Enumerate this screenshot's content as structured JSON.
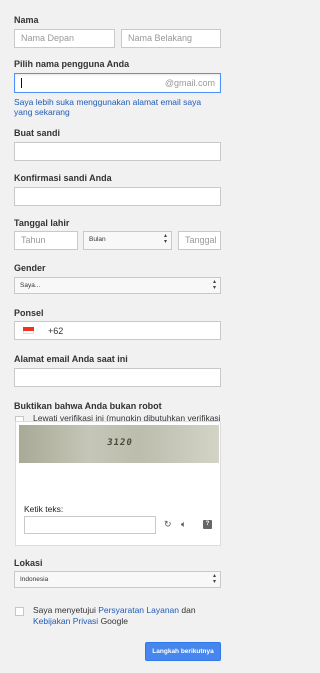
{
  "name": {
    "label": "Nama",
    "first_placeholder": "Nama Depan",
    "last_placeholder": "Nama Belakang"
  },
  "username": {
    "label": "Pilih nama pengguna Anda",
    "value": "",
    "suffix": "@gmail.com",
    "alt_link": "Saya lebih suka menggunakan alamat email saya yang sekarang"
  },
  "password": {
    "label": "Buat sandi",
    "value": ""
  },
  "confirm_password": {
    "label": "Konfirmasi sandi Anda",
    "value": ""
  },
  "birthday": {
    "label": "Tanggal lahir",
    "year_placeholder": "Tahun",
    "month_selected": "Bulan",
    "day_placeholder": "Tanggal"
  },
  "gender": {
    "label": "Gender",
    "selected": "Saya..."
  },
  "phone": {
    "label": "Ponsel",
    "country_code": "+62"
  },
  "current_email": {
    "label": "Alamat email Anda saat ini",
    "value": ""
  },
  "robot": {
    "label": "Buktikan bahwa Anda bukan robot",
    "skip_text": "Lewati verifikasi ini (mungkin dibutuhkan verifikasi telepon)",
    "captcha_text": "3120",
    "type_label": "Ketik teks:",
    "help_glyph": "?"
  },
  "location": {
    "label": "Lokasi",
    "selected": "Indonesia"
  },
  "terms": {
    "prefix": "Saya menyetujui ",
    "tos_link": "Persyaratan Layanan",
    "middle": " dan",
    "privacy_link": "Kebijakan Privasi",
    "suffix": " Google"
  },
  "next_button": "Langkah berikutnya",
  "colors": {
    "accent": "#4787ed",
    "link": "#1f5bb7",
    "focus_border": "#4d90fe"
  },
  "icons": {
    "refresh": "refresh-icon",
    "audio": "audio-icon",
    "help": "help-icon",
    "select_arrow": "updown-arrow-icon"
  }
}
